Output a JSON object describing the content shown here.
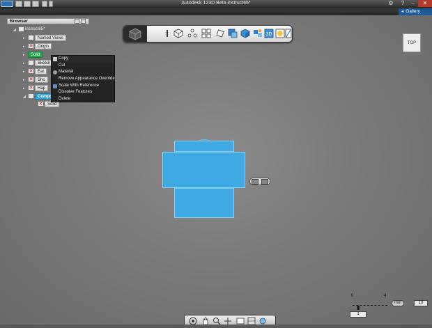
{
  "window": {
    "title": "Autodesk 123D Beta   instruct65*",
    "controls": [
      "minimize",
      "help",
      "close"
    ]
  },
  "gallery": {
    "label": "Gallery"
  },
  "browser": {
    "header": "Browser",
    "root": "instruct65*",
    "nodes": [
      {
        "label": "Named Views"
      },
      {
        "label": "Origin"
      },
      {
        "label": "Solid"
      },
      {
        "label": "Sketch"
      },
      {
        "label": "Ear"
      },
      {
        "label": "Sho"
      },
      {
        "label": "Hap"
      },
      {
        "label": "Compo"
      },
      {
        "label": "Solid"
      }
    ]
  },
  "context_menu": {
    "items": [
      {
        "label": "Copy",
        "highlighted": true
      },
      {
        "label": "Cut"
      },
      {
        "label": "Material"
      },
      {
        "label": "Remove Appearance Override"
      },
      {
        "label": "Scale With Reference"
      },
      {
        "label": "Dissolve Features"
      },
      {
        "label": "Delete"
      }
    ]
  },
  "toolbar": {
    "icons": [
      "view-cube-icon",
      "info-icon",
      "box-icon",
      "primitives-icon",
      "pattern-icon",
      "modify-icon",
      "combine-icon",
      "blue-cube-icon",
      "group-icon",
      "3d-text-icon",
      "materials-icon",
      "measure-icon"
    ]
  },
  "viewcube": {
    "label": "TOP"
  },
  "scale": {
    "tick_left": "0",
    "tick_right": "4",
    "unit": "mm",
    "value": "10",
    "step": "1"
  },
  "navbar": {
    "icons": [
      "orbit-icon",
      "pan-icon",
      "zoom-icon",
      "look-at-icon",
      "fit-icon",
      "view-icon",
      "grid-icon"
    ]
  },
  "colors": {
    "model_blue": "#3ea8e2",
    "selection_green": "#22a84a",
    "selection_blue": "#2da0d8",
    "gallery_blue": "#1f5a96",
    "canvas_gray": "#7a7a7a"
  }
}
